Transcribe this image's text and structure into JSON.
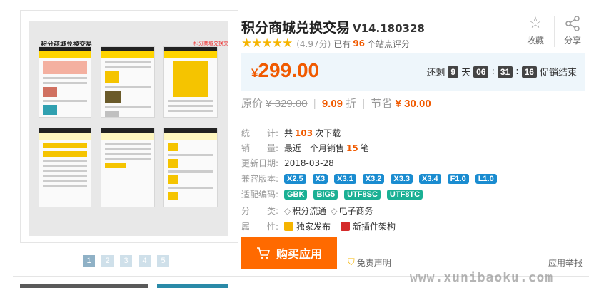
{
  "gallery": {
    "preview_title": "积分商城兑换交易",
    "preview_corner": "积分商城兑换交易",
    "pages": [
      "1",
      "2",
      "3",
      "4",
      "5"
    ],
    "active_page": "1"
  },
  "product": {
    "title": "积分商城兑换交易",
    "version": "V14.180328",
    "rating_score": "(4.97分)",
    "rating_prefix": "已有",
    "rating_count": "96",
    "rating_suffix": "个站点评分"
  },
  "actions": {
    "favorite_label": "收藏",
    "share_label": "分享"
  },
  "price": {
    "currency": "¥",
    "amount": "299.00",
    "countdown_prefix": "还剩",
    "days": "9",
    "days_unit": "天",
    "hours": "06",
    "minutes": "31",
    "seconds": "16",
    "countdown_suffix": "促销结束"
  },
  "original": {
    "label": "原价",
    "price": "¥ 329.00",
    "discount": "9.09",
    "discount_unit": "折",
    "save_label": "节省",
    "save": "¥ 30.00"
  },
  "stats": {
    "downloads_label": "统　　计:",
    "downloads_prefix": "共",
    "downloads": "103",
    "downloads_suffix": "次下载",
    "sales_label": "销　　量:",
    "sales_prefix": "最近一个月销售",
    "sales": "15",
    "sales_suffix": "笔",
    "updated_label": "更新日期:",
    "updated": "2018-03-28",
    "compat_label": "兼容版本:",
    "compat": [
      "X2.5",
      "X3",
      "X3.1",
      "X3.2",
      "X3.3",
      "X3.4",
      "F1.0",
      "L1.0"
    ],
    "encoding_label": "适配编码:",
    "encoding": [
      "GBK",
      "BIG5",
      "UTF8SC",
      "UTF8TC"
    ],
    "category_label": "分　　类:",
    "categories": [
      "积分流通",
      "电子商务"
    ],
    "attr_label": "属　　性:",
    "attributes": [
      "独家发布",
      "新插件架构"
    ]
  },
  "buy": {
    "label": "购买应用",
    "disclaimer": "免责声明",
    "report": "应用举报"
  },
  "watermark": "www.xunibaoku.com"
}
